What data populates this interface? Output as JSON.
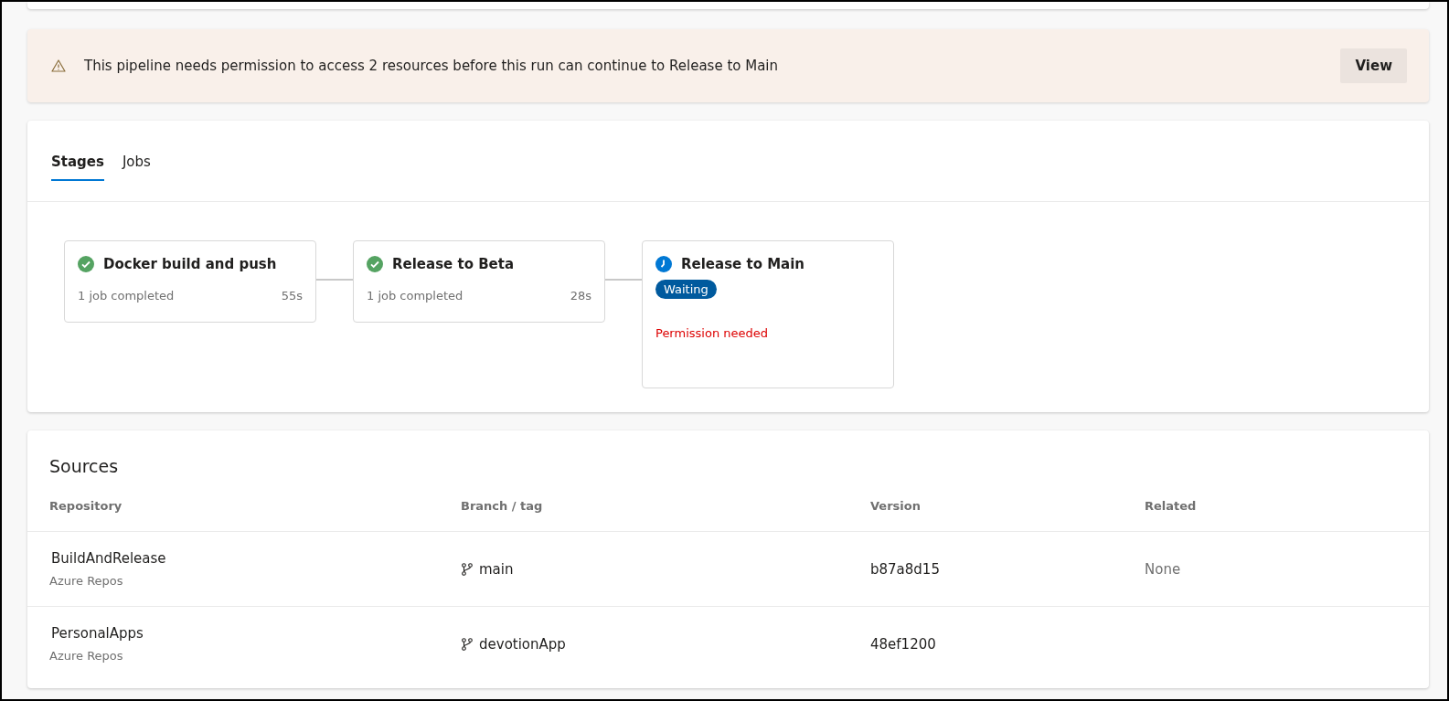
{
  "banner": {
    "message": "This pipeline needs permission to access 2 resources before this run can continue to Release to Main",
    "button": "View"
  },
  "tabs": [
    {
      "label": "Stages",
      "selected": true
    },
    {
      "label": "Jobs",
      "selected": false
    }
  ],
  "stages": [
    {
      "name": "Docker build and push",
      "kind": "succeeded",
      "summary": "1 job completed",
      "duration": "55s"
    },
    {
      "name": "Release to Beta",
      "kind": "succeeded",
      "summary": "1 job completed",
      "duration": "28s"
    },
    {
      "name": "Release to Main",
      "kind": "waiting",
      "badge": "Waiting",
      "note": "Permission needed"
    }
  ],
  "sources": {
    "title": "Sources",
    "columns": [
      "Repository",
      "Branch / tag",
      "Version",
      "Related"
    ],
    "rows": [
      {
        "repository": "BuildAndRelease",
        "provider": "Azure Repos",
        "branch": "main",
        "version": "b87a8d15",
        "related": "None"
      },
      {
        "repository": "PersonalApps",
        "provider": "Azure Repos",
        "branch": "devotionApp",
        "version": "48ef1200"
      }
    ]
  }
}
